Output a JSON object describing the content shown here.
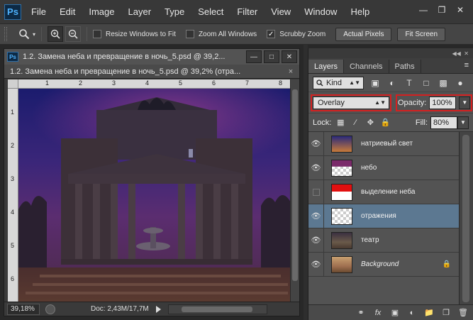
{
  "app": {
    "logo": "Ps"
  },
  "menu": [
    "File",
    "Edit",
    "Image",
    "Layer",
    "Type",
    "Select",
    "Filter",
    "View",
    "Window",
    "Help"
  ],
  "options": {
    "resize_windows": "Resize Windows to Fit",
    "zoom_all": "Zoom All Windows",
    "scrubby_zoom": "Scrubby Zoom",
    "actual_pixels": "Actual Pixels",
    "fit_screen": "Fit Screen"
  },
  "document": {
    "window_title": "1.2. Замена неба и превращение в ночь_5.psd @ 39,2...",
    "tab_label": "1.2. Замена неба и превращение в ночь_5.psd @ 39,2% (отра...",
    "ruler_h": [
      "1",
      "2",
      "3",
      "4",
      "5",
      "6",
      "7",
      "8"
    ],
    "ruler_v": [
      "1",
      "2",
      "3",
      "4",
      "5",
      "6"
    ],
    "zoom": "39,18%",
    "doc_info": "Doc: 2,43M/17,7M"
  },
  "panel": {
    "tabs": [
      "Layers",
      "Channels",
      "Paths"
    ],
    "kind_label": "Kind",
    "blend_mode": "Overlay",
    "opacity_label": "Opacity:",
    "opacity_value": "100%",
    "lock_label": "Lock:",
    "fill_label": "Fill:",
    "fill_value": "80%",
    "layers": [
      {
        "name": "натриевый свет",
        "visible": true
      },
      {
        "name": "небо",
        "visible": true
      },
      {
        "name": "выделение неба",
        "visible": false
      },
      {
        "name": "отражения",
        "visible": true,
        "selected": true
      },
      {
        "name": "театр",
        "visible": true
      },
      {
        "name": "Background",
        "visible": true,
        "locked": true
      }
    ]
  },
  "colors": {
    "highlight_red": "#d42020",
    "selected_layer": "#5c7891"
  }
}
